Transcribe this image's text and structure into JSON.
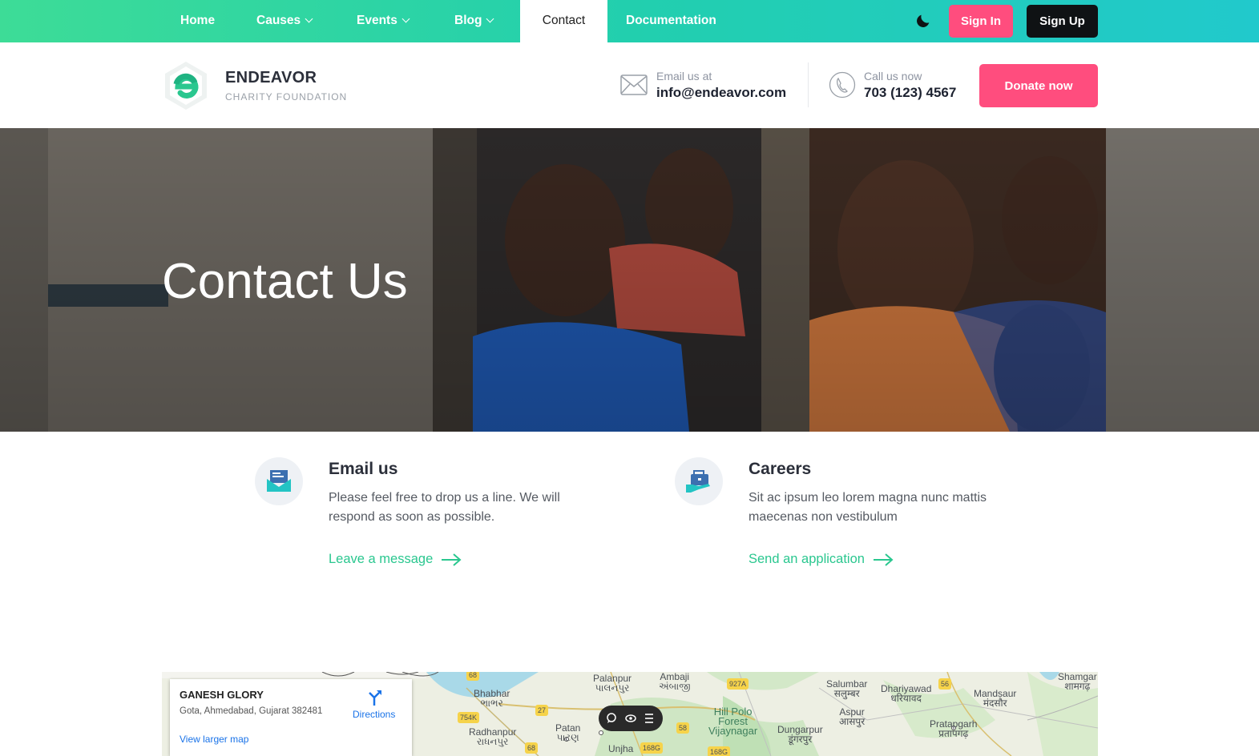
{
  "nav": {
    "items": [
      {
        "label": "Home",
        "dropdown": false
      },
      {
        "label": "Causes",
        "dropdown": true
      },
      {
        "label": "Events",
        "dropdown": true
      },
      {
        "label": "Blog",
        "dropdown": true
      },
      {
        "label": "Contact",
        "dropdown": false,
        "active": true
      },
      {
        "label": "Documentation",
        "dropdown": false
      }
    ],
    "theme_icon": "moon-icon",
    "sign_in": "Sign In",
    "sign_up": "Sign Up"
  },
  "header": {
    "brand_name": "ENDEAVOR",
    "brand_sub": "CHARITY FOUNDATION",
    "email_label": "Email us at",
    "email_value": "info@endeavor.com",
    "phone_label": "Call us now",
    "phone_value": "703 (123) 4567",
    "donate": "Donate now"
  },
  "hero": {
    "title": "Contact Us"
  },
  "cards": [
    {
      "icon": "envelope-open-icon",
      "title": "Email us",
      "text": "Please feel free to drop us a line. We will respond as soon as possible.",
      "link": "Leave a message"
    },
    {
      "icon": "briefcase-icon",
      "title": "Careers",
      "text": "Sit ac ipsum leo lorem magna nunc mattis maecenas non vestibulum",
      "link": "Send an application"
    }
  ],
  "map": {
    "place_name": "GANESH GLORY",
    "address": "Gota, Ahmedabad, Gujarat 382481",
    "directions": "Directions",
    "view_larger": "View larger map",
    "labels": [
      {
        "text": "Palanpur\nપાલનપુર"
      },
      {
        "text": "Ambaji\nઅંબાજી"
      },
      {
        "text": "Bhabhar\nભાભર"
      },
      {
        "text": "Radhanpur\nરાધનપુર"
      },
      {
        "text": "Patan\nપાટણ"
      },
      {
        "text": "Unjha"
      },
      {
        "text": "Hill Polo\nForest\nVijaynagar"
      },
      {
        "text": "Salumbar\nसलुम्बर"
      },
      {
        "text": "Dhariyawad\nधरियावद"
      },
      {
        "text": "Aspur\nआसपुर"
      },
      {
        "text": "Dungarpur\nडूंगरपुर"
      },
      {
        "text": "Mandsaur\nमंदसौर"
      },
      {
        "text": "Pratapgarh\nप्रतापगढ़"
      },
      {
        "text": "Shamgar\nशामगढ़"
      }
    ],
    "shields": [
      "68",
      "27",
      "754K",
      "68",
      "58",
      "168G",
      "168G",
      "927A",
      "56"
    ]
  },
  "colors": {
    "accent_green": "#2ac78f",
    "accent_pink": "#ff4d7e",
    "dark": "#0f1214"
  }
}
